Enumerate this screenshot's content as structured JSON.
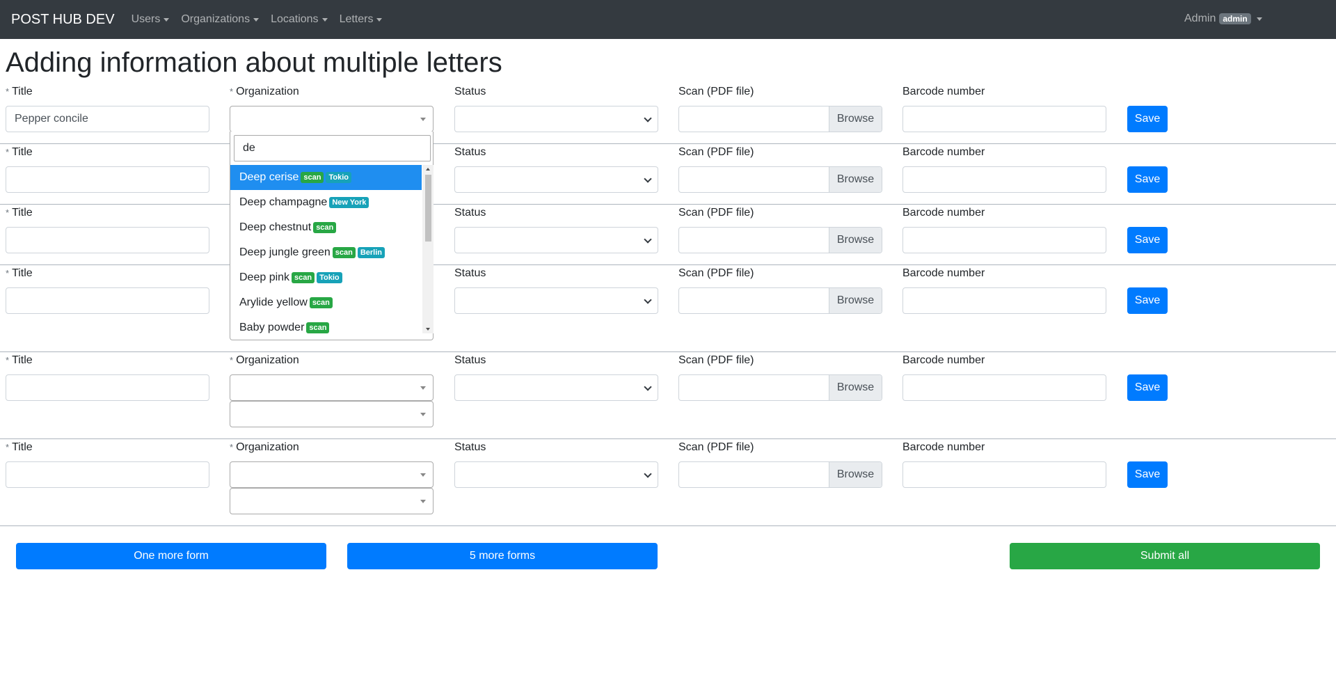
{
  "navbar": {
    "brand": "POST HUB DEV",
    "menus": [
      "Users",
      "Organizations",
      "Locations",
      "Letters"
    ],
    "user_name": "Admin",
    "user_role": "admin"
  },
  "page_title": "Adding information about multiple letters",
  "form_labels": {
    "title": "Title",
    "organization": "Organization",
    "status": "Status",
    "scan": "Scan (PDF file)",
    "barcode": "Barcode number",
    "required_mark": "*",
    "browse": "Browse",
    "save": "Save"
  },
  "forms": [
    {
      "title_value": "Pepper concile"
    },
    {
      "title_value": ""
    },
    {
      "title_value": ""
    },
    {
      "title_value": ""
    },
    {
      "title_value": ""
    },
    {
      "title_value": ""
    }
  ],
  "org_dropdown": {
    "search_value": "de",
    "options": [
      {
        "label": "Deep cerise",
        "badges": [
          "scan",
          "Tokio"
        ],
        "active": true
      },
      {
        "label": "Deep champagne",
        "badges": [
          "New York"
        ]
      },
      {
        "label": "Deep chestnut",
        "badges": [
          "scan"
        ]
      },
      {
        "label": "Deep jungle green",
        "badges": [
          "scan",
          "Berlin"
        ]
      },
      {
        "label": "Deep pink",
        "badges": [
          "scan",
          "Tokio"
        ]
      },
      {
        "label": "Arylide yellow",
        "badges": [
          "scan"
        ]
      },
      {
        "label": "Baby powder",
        "badges": [
          "scan"
        ]
      }
    ]
  },
  "badge_colors": {
    "scan": "#28a745",
    "location": "#17a2b8"
  },
  "buttons": {
    "one_more": "One more form",
    "five_more": "5 more forms",
    "submit_all": "Submit all"
  },
  "colors": {
    "primary": "#007bff",
    "success": "#28a745",
    "navbar": "#343a40"
  }
}
